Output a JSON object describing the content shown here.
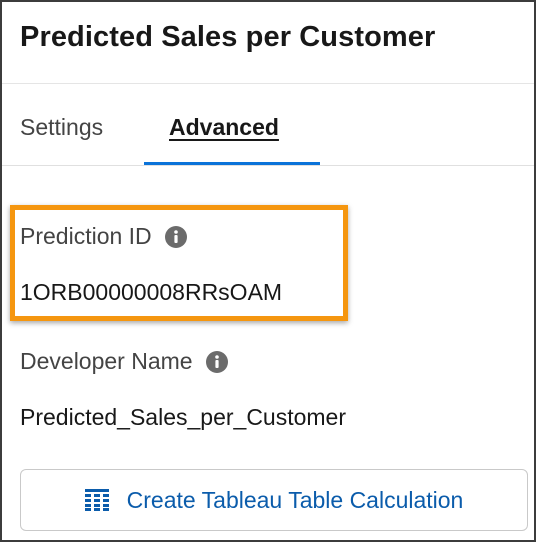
{
  "panel": {
    "title": "Predicted Sales per Customer"
  },
  "tabs": [
    {
      "label": "Settings",
      "active": false
    },
    {
      "label": "Advanced",
      "active": true
    }
  ],
  "fields": {
    "prediction_id": {
      "label": "Prediction ID",
      "value": "1ORB00000008RRsOAM",
      "icon": "info-icon"
    },
    "developer_name": {
      "label": "Developer Name",
      "value": "Predicted_Sales_per_Customer",
      "icon": "info-icon"
    }
  },
  "actions": {
    "create_calc_label": "Create Tableau Table Calculation",
    "create_calc_icon": "table-icon"
  },
  "colors": {
    "accent": "#0b73d9",
    "highlight": "#f5960f",
    "link": "#0b5cab"
  }
}
